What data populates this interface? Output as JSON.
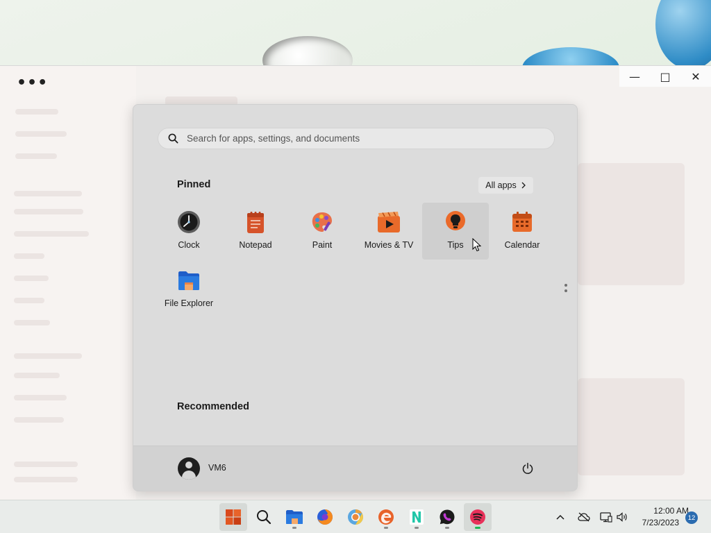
{
  "start_menu": {
    "search": {
      "placeholder": "Search for apps, settings, and documents"
    },
    "pinned_title": "Pinned",
    "all_apps_label": "All apps",
    "pinned_apps": [
      {
        "label": "Clock",
        "icon": "clock-icon"
      },
      {
        "label": "Notepad",
        "icon": "notepad-icon"
      },
      {
        "label": "Paint",
        "icon": "paint-icon"
      },
      {
        "label": "Movies & TV",
        "icon": "movies-tv-icon"
      },
      {
        "label": "Tips",
        "icon": "tips-icon",
        "hovered": true
      },
      {
        "label": "Calendar",
        "icon": "calendar-icon"
      },
      {
        "label": "File Explorer",
        "icon": "file-explorer-icon"
      }
    ],
    "recommended_title": "Recommended",
    "user": {
      "name": "VM6"
    }
  },
  "taskbar": {
    "apps": [
      {
        "name": "start",
        "icon": "windows-start-icon",
        "active": true
      },
      {
        "name": "search",
        "icon": "search-icon"
      },
      {
        "name": "file-explorer",
        "icon": "folder-icon",
        "running": true
      },
      {
        "name": "firefox",
        "icon": "firefox-icon"
      },
      {
        "name": "chrome",
        "icon": "chrome-icon"
      },
      {
        "name": "edge",
        "icon": "edge-icon",
        "running": true
      },
      {
        "name": "notepad-plus",
        "icon": "n-app-icon",
        "running": true
      },
      {
        "name": "whatsapp",
        "icon": "whatsapp-icon",
        "running": true
      },
      {
        "name": "spotify",
        "icon": "spotify-icon",
        "running": true,
        "active": true
      }
    ],
    "clock": {
      "time": "12:00 AM",
      "date": "7/23/2023"
    },
    "notification_count": "12"
  },
  "colors": {
    "accent": "#2b6cb0",
    "spotify_green": "#1db954",
    "menu_bg": "#dcdcdc"
  }
}
